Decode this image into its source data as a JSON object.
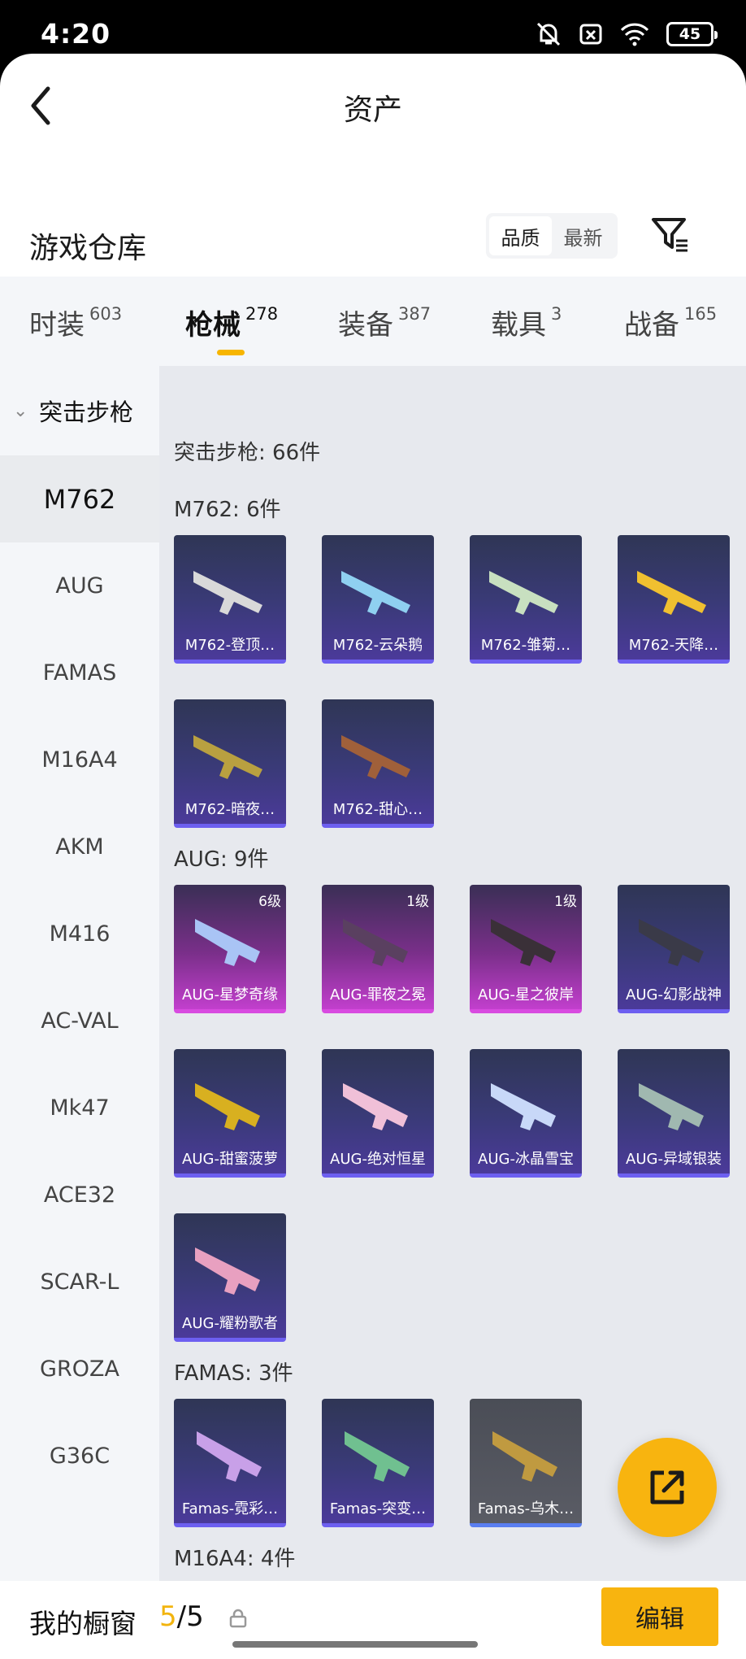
{
  "status": {
    "time": "4:20",
    "battery": "45"
  },
  "header": {
    "title": "资产"
  },
  "warehouse": {
    "title": "游戏仓库",
    "sort_quality": "品质",
    "sort_newest": "最新"
  },
  "tabs": [
    {
      "label": "时装",
      "count": "603"
    },
    {
      "label": "枪械",
      "count": "278"
    },
    {
      "label": "装备",
      "count": "387"
    },
    {
      "label": "载具",
      "count": "3"
    },
    {
      "label": "战备",
      "count": "165"
    }
  ],
  "sidebar": {
    "group": "突击步枪",
    "items": [
      "M762",
      "AUG",
      "FAMAS",
      "M16A4",
      "AKM",
      "M416",
      "AC-VAL",
      "Mk47",
      "ACE32",
      "SCAR-L",
      "GROZA",
      "G36C"
    ]
  },
  "main": {
    "section_title": "突击步枪: 66件",
    "groups": [
      {
        "title": "M762: 6件",
        "items": [
          {
            "name": "M762-登顶…",
            "level": ""
          },
          {
            "name": "M762-云朵鹅",
            "level": ""
          },
          {
            "name": "M762-雏菊…",
            "level": ""
          },
          {
            "name": "M762-天降…",
            "level": ""
          },
          {
            "name": "M762-暗夜…",
            "level": ""
          },
          {
            "name": "M762-甜心…",
            "level": ""
          }
        ]
      },
      {
        "title": "AUG: 9件",
        "items": [
          {
            "name": "AUG-星梦奇缘",
            "level": "6级"
          },
          {
            "name": "AUG-罪夜之冕",
            "level": "1级"
          },
          {
            "name": "AUG-星之彼岸",
            "level": "1级"
          },
          {
            "name": "AUG-幻影战神",
            "level": ""
          },
          {
            "name": "AUG-甜蜜菠萝",
            "level": ""
          },
          {
            "name": "AUG-绝对恒星",
            "level": ""
          },
          {
            "name": "AUG-冰晶雪宝",
            "level": ""
          },
          {
            "name": "AUG-异域银装",
            "level": ""
          },
          {
            "name": "AUG-耀粉歌者",
            "level": ""
          }
        ]
      },
      {
        "title": "FAMAS: 3件",
        "items": [
          {
            "name": "Famas-霓彩…",
            "level": ""
          },
          {
            "name": "Famas-突变…",
            "level": ""
          },
          {
            "name": "Famas-乌木…",
            "level": ""
          }
        ]
      },
      {
        "title": "M16A4: 4件",
        "items": []
      }
    ]
  },
  "bottom": {
    "label": "我的橱窗",
    "current": "5",
    "total": "/5",
    "edit": "编辑"
  },
  "colors": {
    "accent": "#f8b40f",
    "card_purple": "#3a3a78",
    "card_pink": "#c23fcd"
  }
}
